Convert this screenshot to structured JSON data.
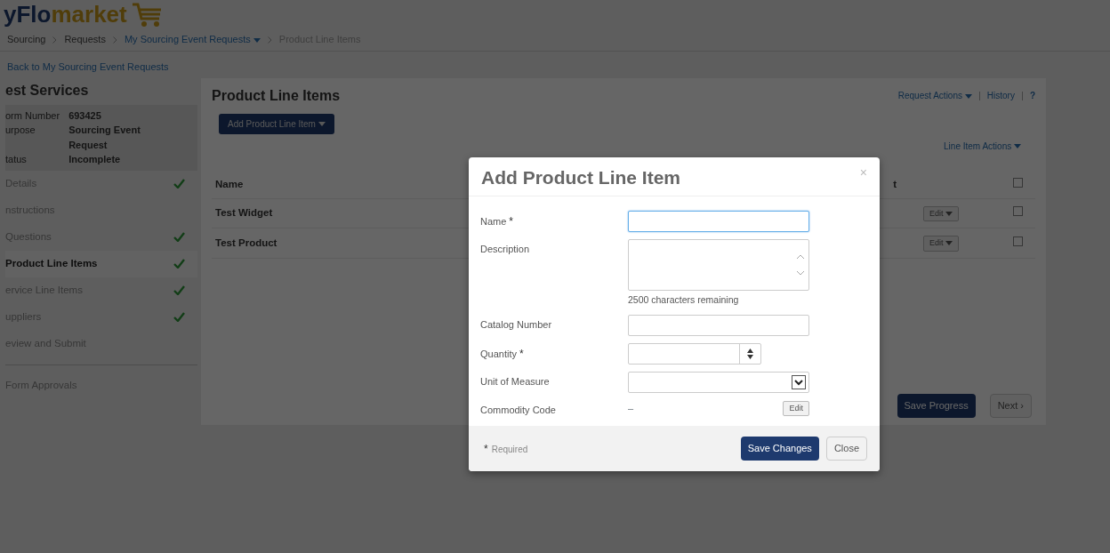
{
  "logo": {
    "part_1": "yFlo",
    "part_2": "market"
  },
  "breadcrumb": [
    {
      "label": "Sourcing",
      "kind": "link"
    },
    {
      "label": "Requests",
      "kind": "link"
    },
    {
      "label": "My Sourcing Event Requests",
      "kind": "menu"
    },
    {
      "label": "Product Line Items",
      "kind": "current"
    }
  ],
  "back_link": "Back to My Sourcing Event Requests",
  "sidebar": {
    "title": "est Services",
    "info": [
      {
        "label": "orm Number",
        "value": "693425"
      },
      {
        "label": "urpose",
        "value": "Sourcing Event Request"
      },
      {
        "label": "tatus",
        "value": "Incomplete"
      }
    ],
    "items": [
      {
        "label": "Details",
        "done": true,
        "selected": false
      },
      {
        "label": "nstructions",
        "done": false,
        "selected": false
      },
      {
        "label": "Questions",
        "done": true,
        "selected": false
      },
      {
        "label": "Product Line Items",
        "done": true,
        "selected": true
      },
      {
        "label": "ervice Line Items",
        "done": true,
        "selected": false
      },
      {
        "label": "uppliers",
        "done": true,
        "selected": false
      },
      {
        "label": "eview and Submit",
        "done": false,
        "selected": false
      }
    ],
    "footer_items": [
      {
        "label": "Form Approvals"
      }
    ]
  },
  "main": {
    "title": "Product Line Items",
    "add_button": "Add Product Line Item",
    "top_actions": [
      {
        "label": "Request Actions",
        "kind": "menu"
      },
      {
        "label": "History",
        "kind": "link"
      },
      {
        "label": "?",
        "kind": "help"
      }
    ],
    "line_item_actions": "Line Item Actions",
    "table": {
      "columns": [
        "Name",
        "t"
      ],
      "rows": [
        {
          "name": "Test Widget",
          "action": "Edit",
          "checked": false
        },
        {
          "name": "Test Product",
          "action": "Edit",
          "checked": false
        }
      ],
      "header_checked": false
    },
    "buttons": [
      {
        "label": "Save Progress",
        "kind": "primary"
      },
      {
        "label": "Next ›",
        "kind": "secondary"
      }
    ]
  },
  "modal": {
    "title": "Add Product Line Item",
    "close": "×",
    "fields": [
      {
        "label": "Name",
        "required": true,
        "kind": "text",
        "focused": true
      },
      {
        "label": "Description",
        "required": false,
        "kind": "textarea",
        "focused": false,
        "note": "2500 characters remaining"
      },
      {
        "label": "Catalog Number",
        "required": false,
        "kind": "text",
        "focused": false
      },
      {
        "label": "Quantity",
        "required": true,
        "kind": "number",
        "focused": false
      },
      {
        "label": "Unit of Measure",
        "required": false,
        "kind": "select",
        "focused": false
      },
      {
        "label": "Commodity Code",
        "required": false,
        "kind": "static",
        "focused": false,
        "value": "–",
        "button": "Edit"
      }
    ],
    "required_mark": "*",
    "required_note": "Required",
    "buttons": [
      {
        "label": "Save Changes",
        "kind": "primary"
      },
      {
        "label": "Close",
        "kind": "secondary"
      }
    ]
  }
}
